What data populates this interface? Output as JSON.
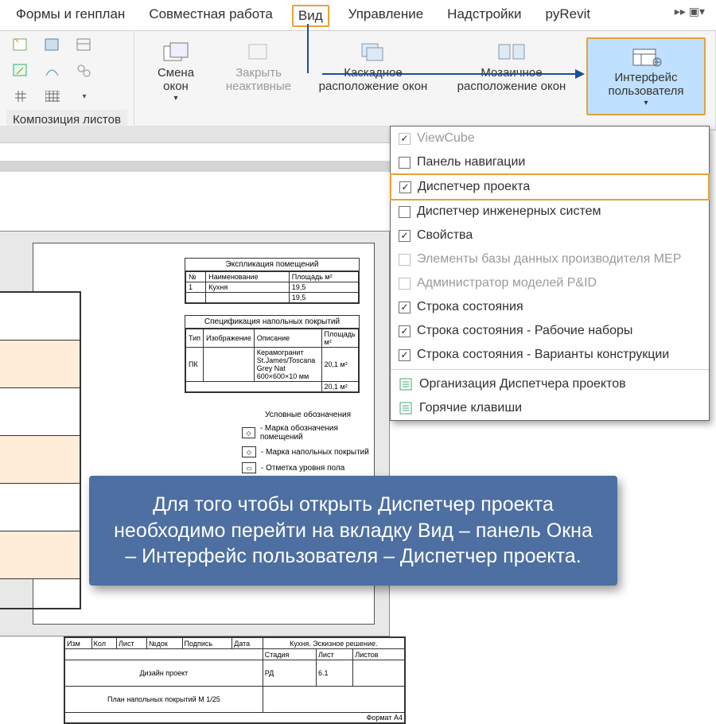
{
  "tabs": {
    "t0": "Формы и генплан",
    "t1": "Совместная работа",
    "t2": "Вид",
    "t3": "Управление",
    "t4": "Надстройки",
    "t5": "pyRevit",
    "nav": "▸▸  ▣▾"
  },
  "ribbon": {
    "panel_label": "Композиция листов",
    "smena": "Смена окон",
    "close_inactive": "Закрыть неактивные",
    "cascade": "Каскадное расположение окон",
    "tile": "Мозаичное расположение окон",
    "ui": "Интерфейс пользователя",
    "dropdown_arrow": "▾"
  },
  "dropdown": {
    "items": [
      {
        "label": "ViewCube",
        "checked": true,
        "disabled": true
      },
      {
        "label": "Панель навигации",
        "checked": false,
        "disabled": false
      },
      {
        "label": "Диспетчер проекта",
        "checked": true,
        "disabled": false,
        "highlight": true
      },
      {
        "label": "Диспетчер инженерных систем",
        "checked": false,
        "disabled": false
      },
      {
        "label": "Свойства",
        "checked": true,
        "disabled": false
      },
      {
        "label": "Элементы базы данных производителя MEP",
        "checked": false,
        "disabled": true
      },
      {
        "label": "Администратор моделей P&ID",
        "checked": false,
        "disabled": true
      },
      {
        "label": "Строка состояния",
        "checked": true,
        "disabled": false
      },
      {
        "label": "Строка состояния - Рабочие наборы",
        "checked": true,
        "disabled": false
      },
      {
        "label": "Строка состояния - Варианты конструкции",
        "checked": true,
        "disabled": false
      }
    ],
    "tool1": "Организация Диспетчера проектов",
    "tool2": "Горячие клавиши"
  },
  "sheet": {
    "table1_title": "Экспликация помещений",
    "table1_cols": [
      "№",
      "Наименование",
      "Площадь м²"
    ],
    "table1_rows": [
      [
        "1",
        "Кухня",
        "19,5"
      ],
      [
        "",
        "",
        "19,5"
      ]
    ],
    "table2_title": "Спецификация напольных покрытий",
    "table2_cols": [
      "Тип",
      "Изображение",
      "Описание",
      "Площадь м²"
    ],
    "table2_row": [
      "ПК",
      "",
      "Керамогранит St.James/Toscana Grey Nat 600×600×10 мм",
      "20,1 м²"
    ],
    "table2_total": "20,1 м²",
    "legend_title": "Условные обозначения",
    "legend1": "- Марка обозначения помещений",
    "legend2": "- Марка напольных покрытий",
    "legend3": "- Отметка уровня пола",
    "tb_title": "Кухня. Эскизное решение.",
    "tb_row2": "Дизайн проект",
    "tb_row3": "План напольных покрытий М 1/25",
    "tb_cells": [
      "Изм",
      "Кол",
      "Лист",
      "№док",
      "Подпись",
      "Дата",
      "Стадия",
      "Лист",
      "Листов",
      "РД",
      "6.1",
      "Формат А4"
    ]
  },
  "tip": "Для того чтобы открыть Диспетчер проекта необходимо перейти на вкладку Вид – панель Окна – Интерфейс пользователя – Диспетчер проекта."
}
